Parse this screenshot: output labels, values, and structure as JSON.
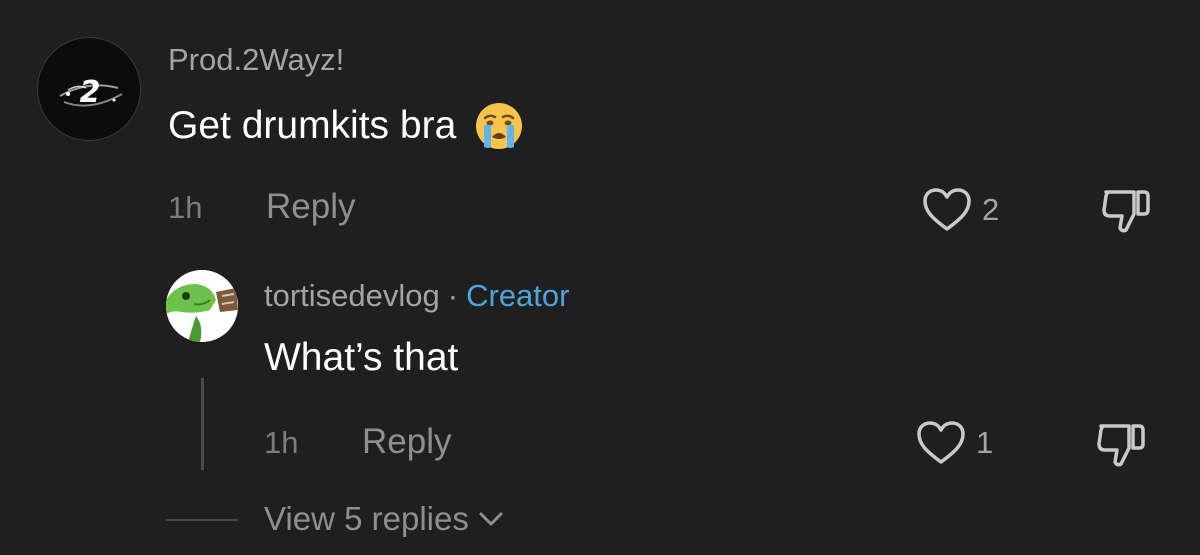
{
  "comment": {
    "username": "Prod.2Wayz!",
    "text": "Get drumkits bra",
    "emoji": "crying-emoji",
    "time": "1h",
    "reply_label": "Reply",
    "likes": "2",
    "avatar_icon": "2wayz-logo-avatar"
  },
  "reply": {
    "username": "tortisedevlog",
    "separator": "·",
    "badge": "Creator",
    "text": "What’s that",
    "time": "1h",
    "reply_label": "Reply",
    "likes": "1",
    "avatar_icon": "turtle-avatar"
  },
  "view_replies": {
    "label": "View 5 replies",
    "icon": "chevron-down-icon"
  },
  "colors": {
    "background": "#1f1f1f",
    "creator_badge": "#4ba5dc",
    "muted_text": "#a4a4a4"
  }
}
